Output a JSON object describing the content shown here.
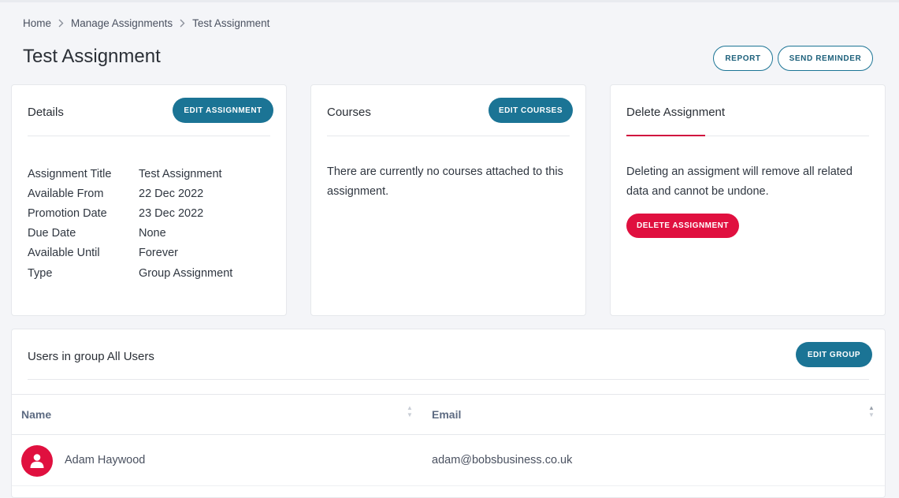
{
  "breadcrumb": {
    "items": [
      "Home",
      "Manage Assignments",
      "Test Assignment"
    ]
  },
  "page": {
    "title": "Test Assignment",
    "report_label": "REPORT",
    "send_reminder_label": "SEND REMINDER"
  },
  "details": {
    "title": "Details",
    "edit_label": "EDIT ASSIGNMENT",
    "rows": [
      {
        "label": "Assignment Title",
        "value": "Test Assignment"
      },
      {
        "label": "Available From",
        "value": "22 Dec 2022"
      },
      {
        "label": "Promotion Date",
        "value": "23 Dec 2022"
      },
      {
        "label": "Due Date",
        "value": "None"
      },
      {
        "label": "Available Until",
        "value": "Forever"
      },
      {
        "label": "Type",
        "value": "Group Assignment"
      }
    ]
  },
  "courses": {
    "title": "Courses",
    "edit_label": "EDIT COURSES",
    "empty_text": "There are currently no courses attached to this assignment."
  },
  "delete": {
    "title": "Delete Assignment",
    "description": "Deleting an assigment will remove all related data and cannot be undone.",
    "button_label": "DELETE ASSIGNMENT"
  },
  "users": {
    "title": "Users in group All Users",
    "edit_label": "EDIT GROUP",
    "columns": [
      "Name",
      "Email"
    ],
    "rows": [
      {
        "name": "Adam Haywood",
        "email": "adam@bobsbusiness.co.uk"
      }
    ]
  },
  "colors": {
    "primary": "#1b7495",
    "danger": "#e0103f",
    "background": "#f4f5f8"
  },
  "icons": {
    "breadcrumb_separator": "chevron-right-icon",
    "sort": "sort-arrows-icon",
    "avatar": "user-icon"
  }
}
